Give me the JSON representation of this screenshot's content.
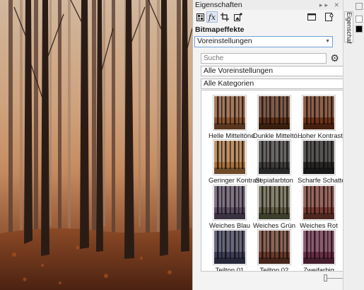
{
  "docker": {
    "title": "Eigenschaften",
    "section_title": "Bitmapeffekte",
    "preset_dropdown": "Voreinstellungen",
    "search_placeholder": "Suche",
    "filter_presets": "Alle Voreinstellungen",
    "filter_categories": "Alle Kategorien",
    "side_tab_label": "Eigenschaf",
    "fx_label": "fx"
  },
  "presets": [
    {
      "label": "Helle Mitteltöne",
      "tint": "#8a5430"
    },
    {
      "label": "Dunkle Mitteltö...",
      "tint": "#5a2e16"
    },
    {
      "label": "Hoher Kontrast",
      "tint": "#6e3418"
    },
    {
      "label": "Geringer Kontrast",
      "tint": "#a9723d"
    },
    {
      "label": "Sepiafarbton",
      "tint": "#3d3d3d"
    },
    {
      "label": "Scharfe Schatten",
      "tint": "#262626"
    },
    {
      "label": "Weiches Blau",
      "tint": "#5a4d66"
    },
    {
      "label": "Weiches Grün",
      "tint": "#5f5e44"
    },
    {
      "label": "Weiches Rot",
      "tint": "#7a3c34"
    },
    {
      "label": "Teilton 01",
      "tint": "#3c3e5a"
    },
    {
      "label": "Teilton 02",
      "tint": "#6a3a2a"
    },
    {
      "label": "Zweifarbig",
      "tint": "#6a2e48"
    }
  ],
  "icons": [
    "bitmap-icon",
    "fx-icon",
    "crop-icon",
    "image-adjust-icon",
    "page-icon",
    "page-settings-icon"
  ]
}
